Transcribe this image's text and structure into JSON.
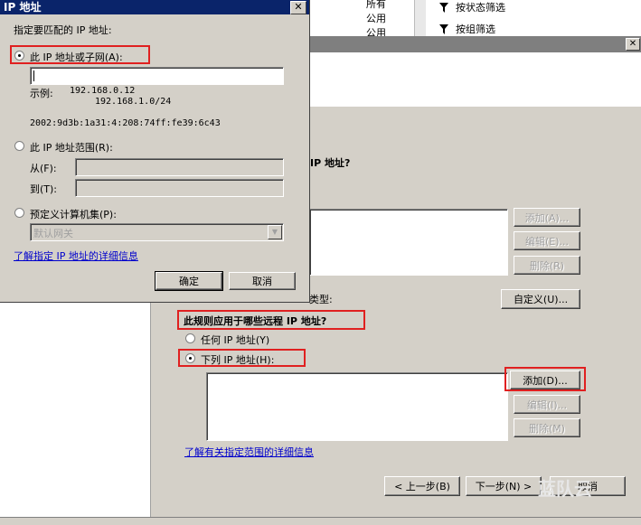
{
  "background": {
    "list_items": [
      "所有",
      "公用",
      "公用"
    ],
    "actions": [
      "按状态筛选",
      "按组筛选"
    ]
  },
  "wizard": {
    "header_question": "IP 地址?",
    "local_list_buttons": {
      "add": "添加(A)...",
      "edit": "编辑(E)...",
      "delete": "删除(R)"
    },
    "type_label": "类型:",
    "customize_button": "自定义(U)...",
    "remote_question": "此规则应用于哪些远程 IP 地址?",
    "any_ip": "任何 IP 地址(Y)",
    "these_ips": "下列 IP 地址(H):",
    "remote_list_buttons": {
      "add": "添加(D)...",
      "edit": "编辑(I)...",
      "delete": "删除(M)"
    },
    "scope_link": "了解有关指定范围的详细信息",
    "nav": {
      "back": "< 上一步(B)",
      "next": "下一步(N) >",
      "cancel": "取消"
    }
  },
  "ip_dialog": {
    "title": "IP 地址",
    "instruction": "指定要匹配的 IP 地址:",
    "option_subnet": "此 IP 地址或子网(A):",
    "subnet_value": "",
    "example_label": "示例:",
    "example_ipv4": "192.168.0.12",
    "example_ipv4_subnet": "192.168.1.0/24",
    "example_ipv6": "2002:9d3b:1a31:4:208:74ff:fe39:6c43",
    "option_range": "此 IP 地址范围(R):",
    "from_label": "从(F):",
    "to_label": "到(T):",
    "option_predefined": "预定义计算机集(P):",
    "predefined_value": "默认网关",
    "help_link": "了解指定 IP 地址的详细信息",
    "ok": "确定",
    "cancel": "取消"
  },
  "watermark": "蓝队云"
}
